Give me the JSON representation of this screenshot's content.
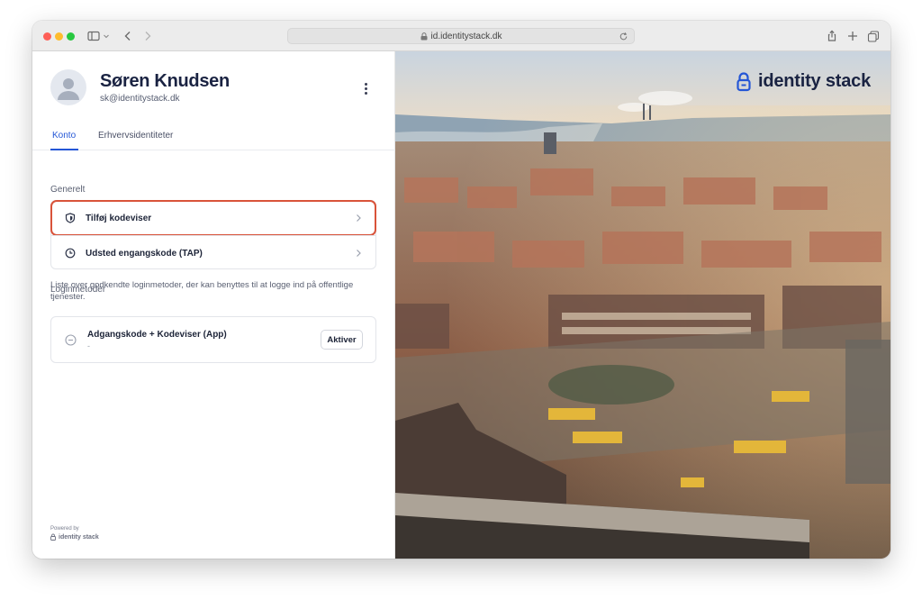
{
  "browser": {
    "url": "id.identitystack.dk"
  },
  "profile": {
    "name": "Søren Knudsen",
    "email": "sk@identitystack.dk"
  },
  "tabs": [
    {
      "label": "Konto",
      "active": true
    },
    {
      "label": "Erhvervsidentiteter",
      "active": false
    }
  ],
  "general": {
    "heading": "Generelt",
    "items": [
      {
        "label": "Tilføj kodeviser",
        "icon": "shield-icon",
        "highlighted": true
      },
      {
        "label": "Udsted engangskode (TAP)",
        "icon": "clock-icon",
        "highlighted": false
      }
    ]
  },
  "login_methods": {
    "heading": "Loginmetoder",
    "description": "Liste over godkendte loginmetoder, der kan benyttes til at logge ind på offentlige tjenester.",
    "items": [
      {
        "label": "Adgangskode + Kodeviser (App)",
        "sub": "-",
        "action": "Aktiver",
        "icon": "minus-circle-icon"
      }
    ]
  },
  "footer": {
    "powered_by": "Powered by",
    "brand": "identity stack"
  },
  "hero": {
    "brand": "identity stack"
  },
  "colors": {
    "accent": "#2456d6",
    "highlight": "#d9533a",
    "brand_text": "#1a2342"
  }
}
